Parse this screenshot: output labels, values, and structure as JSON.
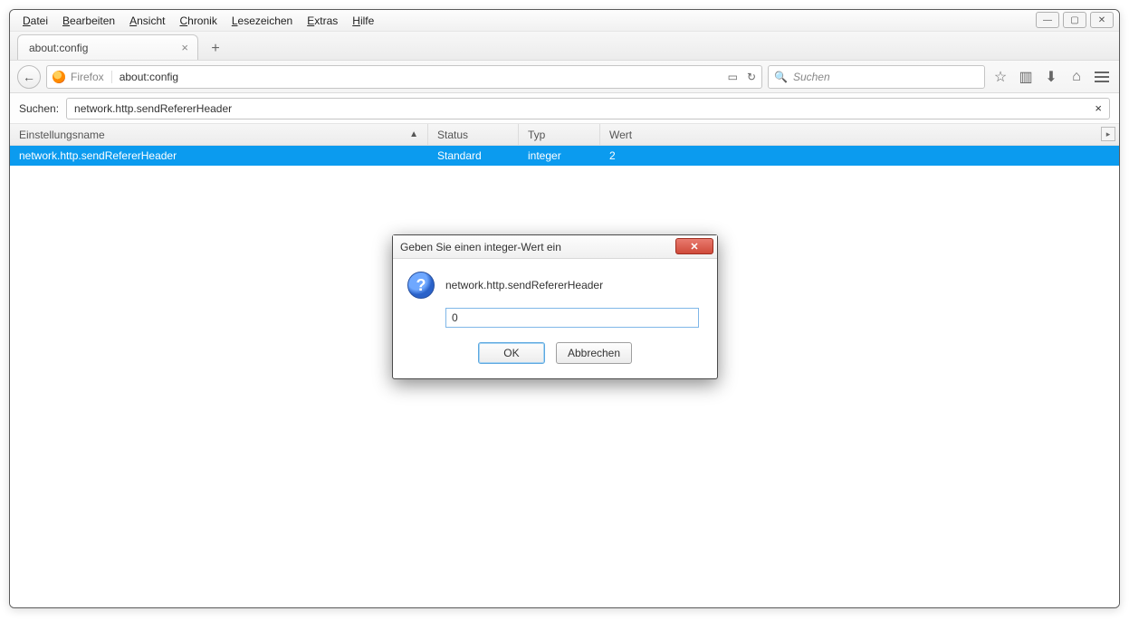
{
  "menu": {
    "file": "Datei",
    "edit": "Bearbeiten",
    "view": "Ansicht",
    "history": "Chronik",
    "bookmarks": "Lesezeichen",
    "extras": "Extras",
    "help": "Hilfe"
  },
  "tab": {
    "title": "about:config"
  },
  "urlbar": {
    "identity": "Firefox",
    "url": "about:config"
  },
  "search": {
    "placeholder": "Suchen"
  },
  "config": {
    "search_label": "Suchen:",
    "search_value": "network.http.sendRefererHeader",
    "headers": {
      "name": "Einstellungsname",
      "status": "Status",
      "type": "Typ",
      "value": "Wert"
    },
    "row": {
      "name": "network.http.sendRefererHeader",
      "status": "Standard",
      "type": "integer",
      "value": "2"
    }
  },
  "dialog": {
    "title": "Geben Sie einen integer-Wert ein",
    "pref_name": "network.http.sendRefererHeader",
    "input_value": "0",
    "ok": "OK",
    "cancel": "Abbrechen"
  }
}
